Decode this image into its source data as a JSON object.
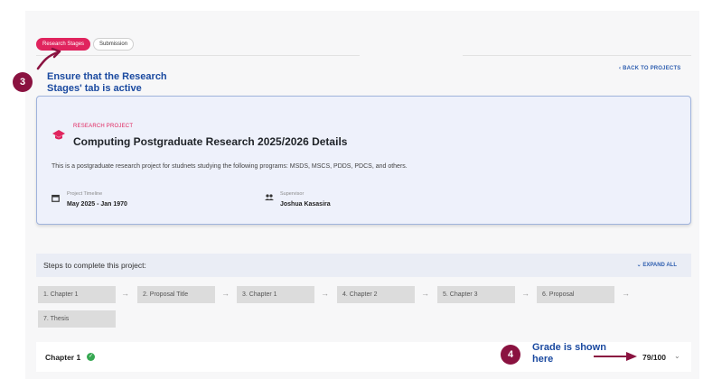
{
  "tabs": [
    {
      "label": "Research Stages",
      "active": true
    },
    {
      "label": "Submission",
      "active": false
    }
  ],
  "back_link": "BACK TO PROJECTS",
  "back_chevron": "‹",
  "annotations": [
    {
      "number": "3",
      "text": "Ensure that the Research Stages' tab is active"
    },
    {
      "number": "4",
      "text": "Grade is shown here"
    }
  ],
  "project": {
    "kicker": "RESEARCH PROJECT",
    "title": "Computing Postgraduate Research 2025/2026 Details",
    "description": "This is a postgraduate research project for studnets studying the following programs: MSDS, MSCS, PDDS, PDCS, and others.",
    "timeline_label": "Project Timeline",
    "timeline_value": "May 2025 - Jan 1970",
    "supervisor_label": "Supervisor",
    "supervisor_value": "Joshua Kasasira"
  },
  "steps_section": {
    "title": "Steps to complete this project:",
    "expand_label": "EXPAND ALL",
    "expand_chevron": "⌄"
  },
  "steps": [
    "1. Chapter 1",
    "2. Proposal Title",
    "3. Chapter 1",
    "4. Chapter 2",
    "5. Chapter 3",
    "6. Proposal",
    "7. Thesis"
  ],
  "step_arrow": "→",
  "chapter": {
    "title": "Chapter 1",
    "check": "✓",
    "grade": "79/100",
    "grade_chevron": "⌄"
  },
  "colors": {
    "accent": "#e0245e",
    "link": "#2f5fb0",
    "annotation_badge": "#8a1240",
    "annotation_text": "#1b4aa0",
    "card_bg": "#eef1fb",
    "success": "#36a852"
  },
  "icons": {
    "cap": "graduation-cap-icon",
    "calendar": "calendar-icon",
    "people": "people-icon",
    "check": "check-circle-icon",
    "arrow": "arrow-right-icon"
  }
}
